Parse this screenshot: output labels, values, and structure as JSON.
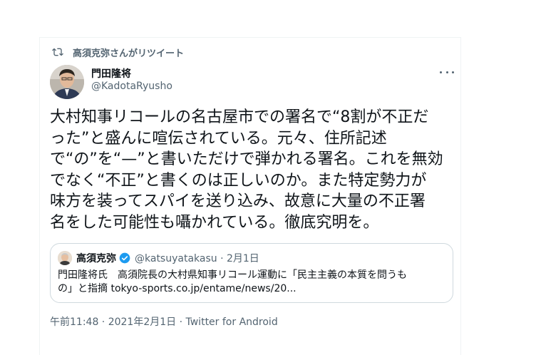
{
  "retweet": {
    "icon": "retweet-icon",
    "label": "高須克弥さんがリツイート"
  },
  "tweet": {
    "author_name": "門田隆将",
    "author_handle": "@KadotaRyusho",
    "more_icon": "more-icon",
    "body_lines": [
      "大村知事リコールの名古屋市での署名で“8割が不正だ",
      "った”と盛んに喧伝されている。元々、住所記述",
      "で“の”を“—”と書いただけで弾かれる署名。これを無効",
      "でなく“不正”と書くのは正しいのか。また特定勢力が",
      "味方を装ってスパイを送り込み、故意に大量の不正署",
      "名をした可能性も囁かれている。徹底究明を。"
    ]
  },
  "quote": {
    "author_name": "高須克弥",
    "verified_icon": "verified-badge-icon",
    "handle_date": "@katsuyatakasu · 2月1日",
    "text_lines": [
      "門田隆将氏　高須院長の大村県知事リコール運動に「民主主義の本質を問うも",
      "の」と指摘 tokyo-sports.co.jp/entame/news/20..."
    ]
  },
  "meta": {
    "time_date": "午前11:48 · 2021年2月1日",
    "separator": " · ",
    "source": "Twitter for Android"
  },
  "colors": {
    "text_primary": "#0f1419",
    "text_secondary": "#536471",
    "verified_blue": "#1d9bf0",
    "border": "#cfd9de"
  }
}
